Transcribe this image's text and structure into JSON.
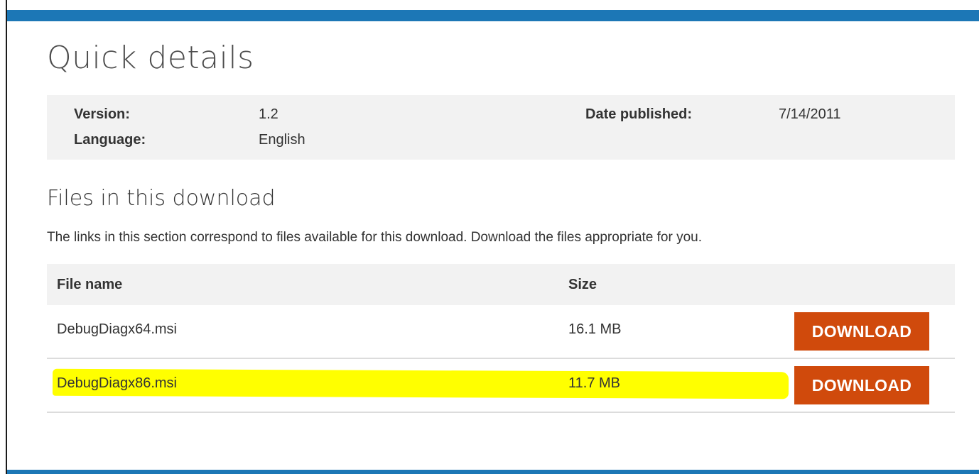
{
  "page": {
    "title": "Quick details",
    "accent_color": "#1c77b6",
    "highlight_color": "#ffff00"
  },
  "details": {
    "version_label": "Version:",
    "version_value": "1.2",
    "language_label": "Language:",
    "language_value": "English",
    "date_label": "Date published:",
    "date_value": "7/14/2011"
  },
  "files_section": {
    "heading": "Files in this download",
    "description": "The links in this section correspond to files available for this download. Download the files appropriate for you.",
    "columns": [
      "File name",
      "Size"
    ],
    "button_color": "#d04a0c",
    "rows": [
      {
        "name": "DebugDiagx64.msi",
        "size": "16.1 MB",
        "button": "DOWNLOAD",
        "highlighted": false
      },
      {
        "name": "DebugDiagx86.msi",
        "size": "11.7 MB",
        "button": "DOWNLOAD",
        "highlighted": true
      }
    ]
  }
}
